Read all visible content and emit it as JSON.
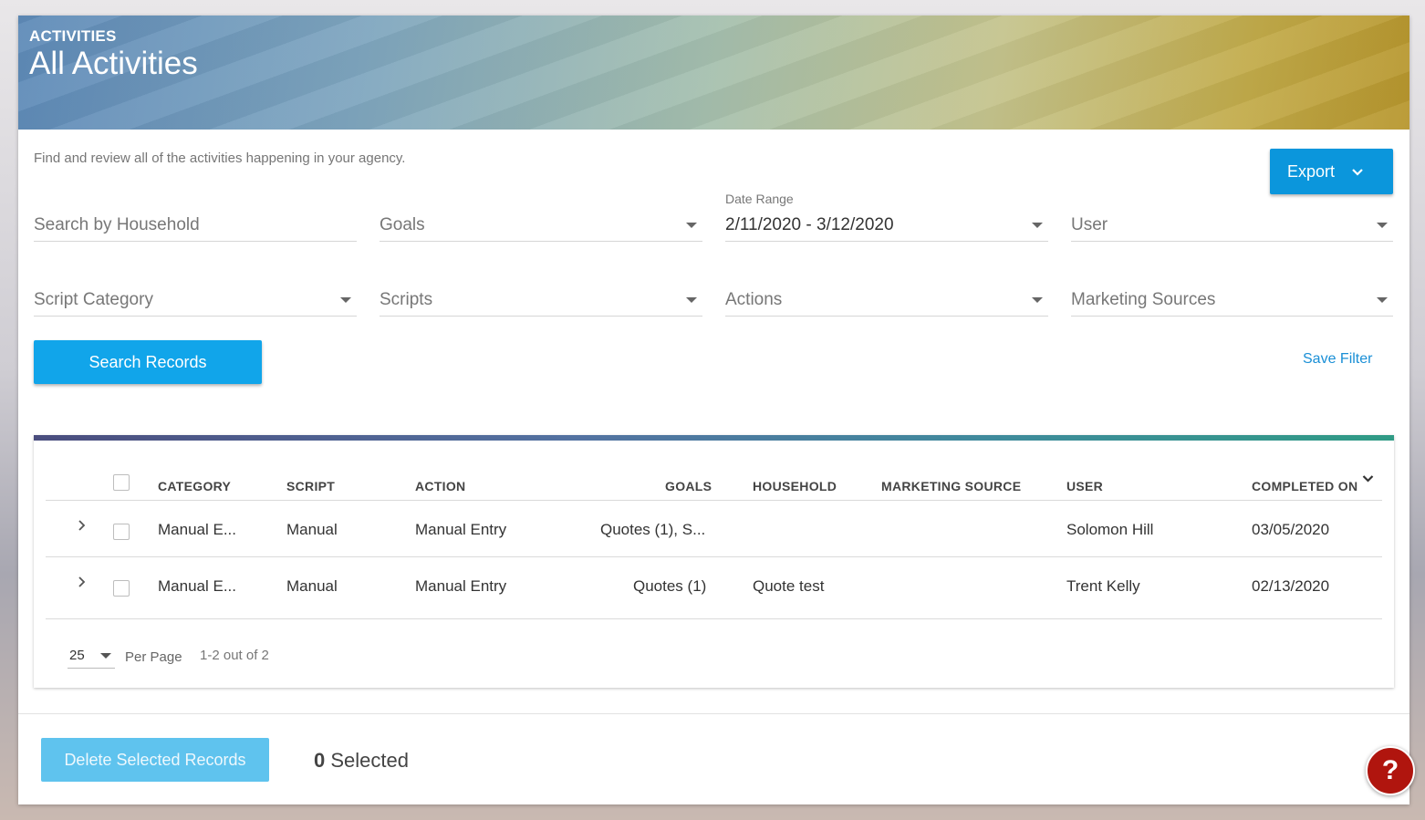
{
  "header": {
    "section": "ACTIVITIES",
    "title": "All Activities"
  },
  "description": "Find and review all of the activities happening in your agency.",
  "export": {
    "label": "Export",
    "icon": "chevron-down-icon"
  },
  "filters": {
    "household_placeholder": "Search by Household",
    "goals": "Goals",
    "date_range_label": "Date Range",
    "date_range_value": "2/11/2020 - 3/12/2020",
    "user": "User",
    "script_category": "Script Category",
    "scripts": "Scripts",
    "actions": "Actions",
    "marketing_sources": "Marketing Sources"
  },
  "search_button": "Search Records",
  "save_filter": "Save Filter",
  "table": {
    "columns": [
      "CATEGORY",
      "SCRIPT",
      "ACTION",
      "GOALS",
      "HOUSEHOLD",
      "MARKETING SOURCE",
      "USER",
      "COMPLETED ON"
    ],
    "sort_icon": "chevron-down-icon",
    "rows": [
      {
        "category": "Manual E...",
        "script": "Manual",
        "action": "Manual Entry",
        "goals": "Quotes (1), S...",
        "household": "",
        "marketing_source": "",
        "user": "Solomon Hill",
        "completed_on": "03/05/2020"
      },
      {
        "category": "Manual E...",
        "script": "Manual",
        "action": "Manual Entry",
        "goals": "Quotes (1)",
        "household": "Quote test",
        "marketing_source": "",
        "user": "Trent Kelly",
        "completed_on": "02/13/2020"
      }
    ]
  },
  "pagination": {
    "per_page_value": "25",
    "per_page_label": "Per Page",
    "count_text": "1-2 out of 2"
  },
  "footer": {
    "delete_button": "Delete Selected Records",
    "selected_count": "0",
    "selected_label": " Selected"
  },
  "help": {
    "label": "?"
  },
  "colors": {
    "primary": "#11a5ea",
    "export": "#0b96dc",
    "disabled": "#5fc3ee",
    "help": "#b0150e",
    "link": "#1a8fd6"
  }
}
